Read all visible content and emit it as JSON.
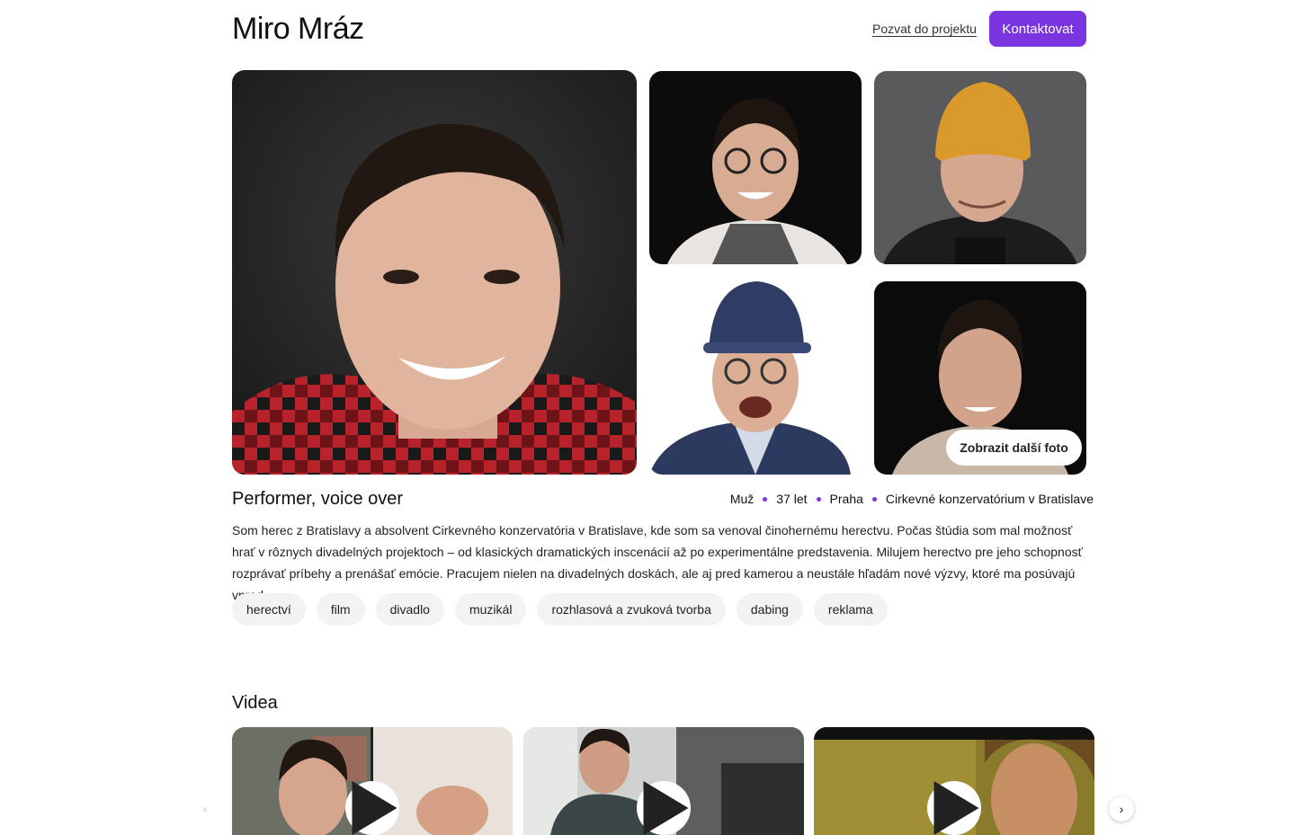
{
  "profile": {
    "name": "Miro Mráz",
    "role": "Performer, voice over",
    "facts": [
      "Muž",
      "37 let",
      "Praha",
      "Cirkevné konzervatórium v Bratislave"
    ],
    "bio": "Som herec z Bratislavy a absolvent Cirkevného konzervatória v Bratislave, kde som sa venoval činohernému herectvu. Počas štúdia som mal možnosť hrať v rôznych divadelných projektoch – od klasických dramatických inscenácií až po experimentálne predstavenia. Milujem herectvo pre jeho schopnosť rozprávať príbehy a prenášať emócie. Pracujem nielen na divadelných doskách, ale aj pred kamerou a neustále hľadám nové výzvy, ktoré ma posúvajú vpred.",
    "tags": [
      "herectví",
      "film",
      "divadlo",
      "muzikál",
      "rozhlasová a zvuková tvorba",
      "dabing",
      "reklama"
    ]
  },
  "header": {
    "invite_label": "Pozvat do projektu",
    "contact_label": "Kontaktovat"
  },
  "gallery": {
    "more_label": "Zobrazit další foto"
  },
  "videos": {
    "title": "Videa"
  },
  "colors": {
    "accent": "#7a35e0",
    "tag_bg": "#f3f3f4"
  }
}
